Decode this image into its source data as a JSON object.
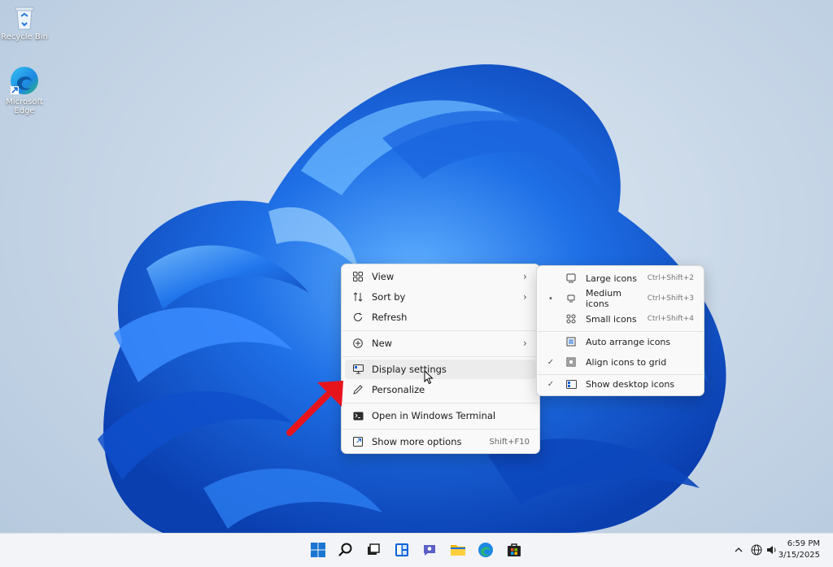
{
  "desktop": {
    "icons": [
      {
        "label": "Recycle Bin"
      },
      {
        "label": "Microsoft Edge"
      }
    ]
  },
  "context_menu": {
    "items": [
      {
        "label": "View",
        "icon": "grid-icon",
        "submenu": true
      },
      {
        "label": "Sort by",
        "icon": "sort-icon",
        "submenu": true
      },
      {
        "label": "Refresh",
        "icon": "refresh-icon"
      },
      {
        "label": "New",
        "icon": "plus-circle-icon",
        "submenu": true
      },
      {
        "label": "Display settings",
        "icon": "monitor-icon",
        "highlighted": true
      },
      {
        "label": "Personalize",
        "icon": "pen-icon"
      },
      {
        "label": "Open in Windows Terminal",
        "icon": "terminal-icon"
      },
      {
        "label": "Show more options",
        "icon": "expand-icon",
        "shortcut": "Shift+F10"
      }
    ]
  },
  "view_submenu": {
    "items": [
      {
        "label": "Large icons",
        "shortcut": "Ctrl+Shift+2",
        "mark": ""
      },
      {
        "label": "Medium icons",
        "shortcut": "Ctrl+Shift+3",
        "mark": "•"
      },
      {
        "label": "Small icons",
        "shortcut": "Ctrl+Shift+4",
        "mark": ""
      },
      {
        "label": "Auto arrange icons",
        "shortcut": "",
        "mark": ""
      },
      {
        "label": "Align icons to grid",
        "shortcut": "",
        "mark": "✓"
      },
      {
        "label": "Show desktop icons",
        "shortcut": "",
        "mark": "✓"
      }
    ]
  },
  "taskbar": {
    "apps": [
      "start-icon",
      "search-icon",
      "task-view-icon",
      "widgets-icon",
      "chat-icon",
      "file-explorer-icon",
      "edge-icon",
      "store-icon"
    ],
    "time": "6:59 PM",
    "date": "3/15/2025"
  },
  "colors": {
    "accent": "#0a62d8",
    "annotation_arrow": "#e8141c"
  }
}
